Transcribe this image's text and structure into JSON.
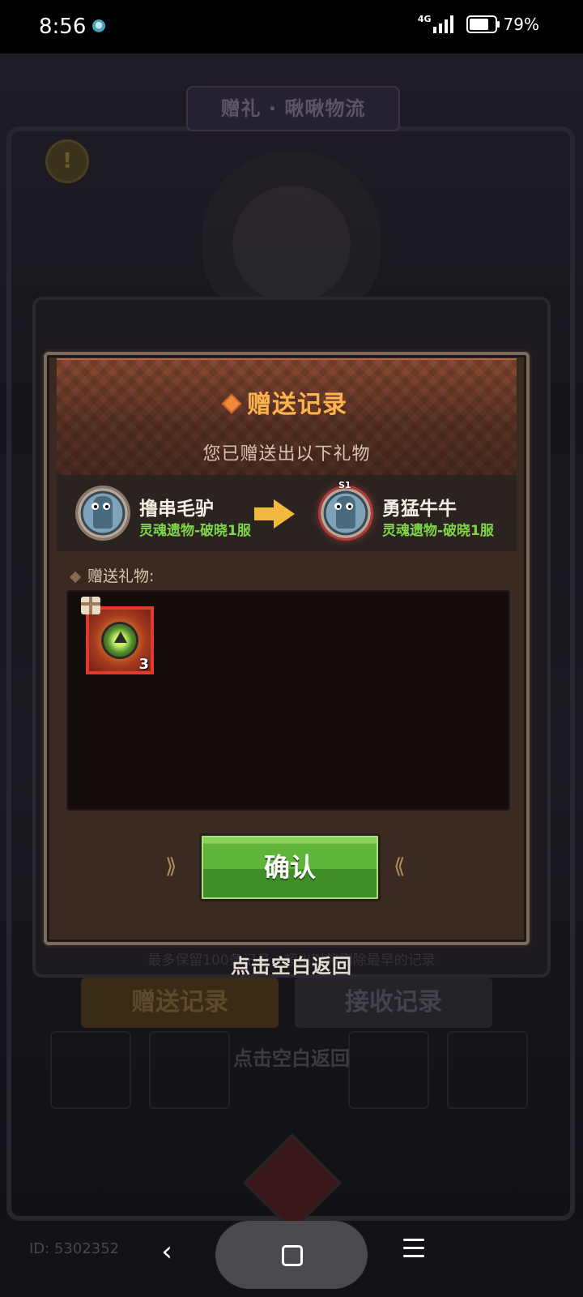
{
  "status_bar": {
    "time": "8:56",
    "network": "4G",
    "battery_percent": "79%",
    "battery_level": 0.79
  },
  "background": {
    "title": "赠礼 · 啾啾物流",
    "tab_send": "赠送记录",
    "tab_receive": "接收记录",
    "note": "最多保留100条记录，超出时将删除最早的记录",
    "hint": "点击空白返回",
    "id_label": "ID: 5302352"
  },
  "dialog": {
    "title": "赠送记录",
    "subtitle": "您已赠送出以下礼物",
    "sender": {
      "name": "撸串毛驴",
      "server": "灵魂遗物-破晓1服"
    },
    "receiver": {
      "name": "勇猛牛牛",
      "server": "灵魂遗物-破晓1服",
      "badge": "S1"
    },
    "gifts_label": "赠送礼物:",
    "gifts": [
      {
        "icon": "green-gem-icon",
        "count": "3",
        "quality_color": "#e03a2a"
      }
    ],
    "confirm_label": "确认"
  },
  "tap_hint": "点击空白返回",
  "colors": {
    "title_accent": "#ffb34d",
    "server_text": "#7fd64a",
    "confirm_green": "#5fb43a"
  }
}
